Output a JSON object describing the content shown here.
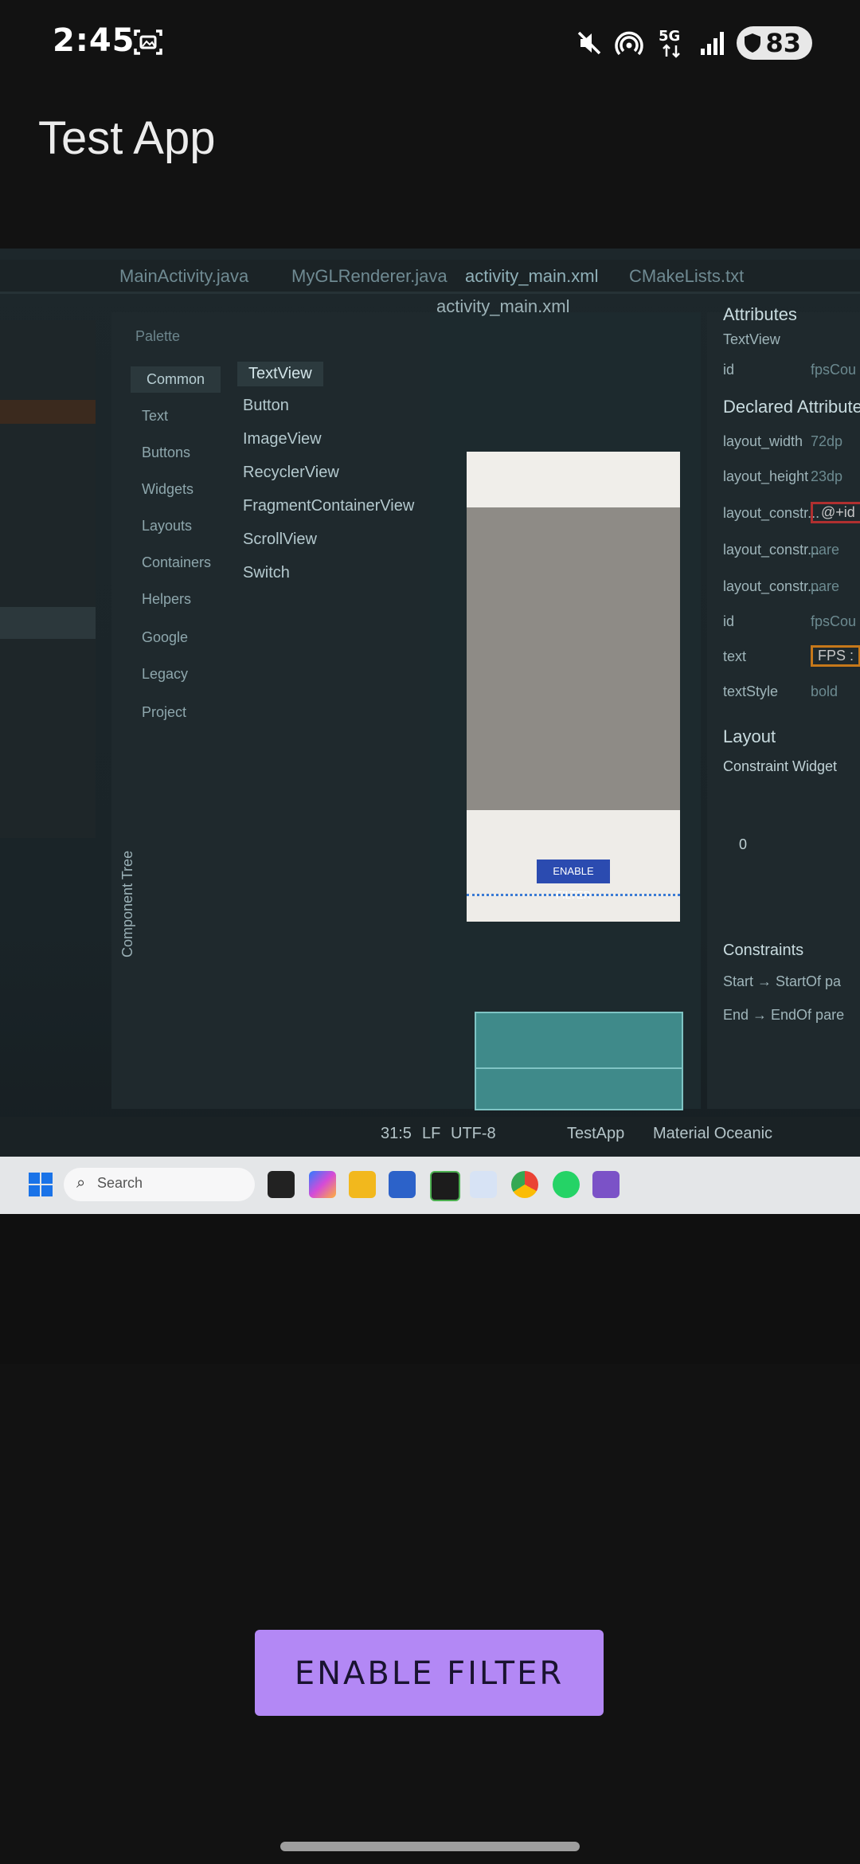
{
  "status_bar": {
    "time": "2:45",
    "battery": "83",
    "network": "5G",
    "icons": [
      "screenshot-icon",
      "mute-icon",
      "hotspot-icon",
      "5g-icon",
      "signal-icon",
      "battery-icon"
    ]
  },
  "app_bar": {
    "title": "Test App"
  },
  "preview": {
    "ide_tabs": [
      "MainActivity.java",
      "MyGLRenderer.java",
      "activity_main.xml",
      "CMakeLists.txt"
    ],
    "file_label": "activity_main.xml",
    "palette_title": "Palette",
    "palette_categories": [
      "Common",
      "Text",
      "Buttons",
      "Widgets",
      "Layouts",
      "Containers",
      "Helpers",
      "Google",
      "Legacy",
      "Project"
    ],
    "palette_items": [
      "TextView",
      "Button",
      "ImageView",
      "RecyclerView",
      "FragmentContainerView",
      "ScrollView",
      "Switch"
    ],
    "component_tree": "Component Tree",
    "mini_button": "ENABLE FILTER",
    "attributes": {
      "title": "Attributes",
      "selected": "TextView",
      "id_label": "id",
      "id_value": "fpsCou",
      "section": "Declared Attributes",
      "rows": [
        {
          "k": "layout_width",
          "v": "72dp"
        },
        {
          "k": "layout_height",
          "v": "23dp"
        },
        {
          "k": "layout_constr...",
          "v": "@+id"
        },
        {
          "k": "layout_constr...",
          "v": "pare"
        },
        {
          "k": "layout_constr...",
          "v": "pare"
        },
        {
          "k": "id",
          "v": "fpsCou"
        },
        {
          "k": "text",
          "v": "FPS :"
        },
        {
          "k": "textStyle",
          "v": "bold"
        }
      ],
      "layout_section": "Layout",
      "constraint_widget": "Constraint Widget",
      "constraint_value": "0",
      "constraints_section": "Constraints",
      "constraint_start": "Start → StartOf pa",
      "constraint_end": "End → EndOf pare"
    },
    "status_line": {
      "position": "31:5",
      "line_ending": "LF",
      "encoding": "UTF-8",
      "project": "TestApp",
      "theme": "Material Oceanic"
    },
    "taskbar_search": "Search"
  },
  "bottom_button": {
    "label": "ENABLE FILTER"
  },
  "colors": {
    "background": "#121212",
    "button": "#b388f5",
    "text": "#e6e6e6"
  }
}
